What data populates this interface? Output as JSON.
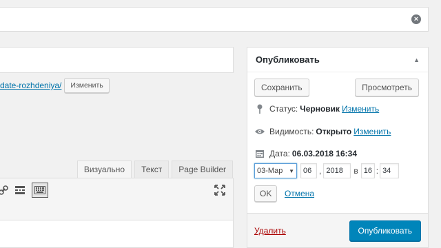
{
  "permalink": {
    "slug": "date-rozhdeniya/",
    "edit_label": "Изменить"
  },
  "editor": {
    "tabs": [
      "Визуально",
      "Текст",
      "Page Builder"
    ]
  },
  "publish": {
    "title": "Опубликовать",
    "save_label": "Сохранить",
    "preview_label": "Просмотреть",
    "status_label": "Статус:",
    "status_value": "Черновик",
    "status_edit": "Изменить",
    "visibility_label": "Видимость:",
    "visibility_value": "Открыто",
    "visibility_edit": "Изменить",
    "date_label": "Дата:",
    "date_value": "06.03.2018 16:34",
    "month_selected": "03-Мар",
    "day": "06",
    "year": "2018",
    "at": "в",
    "hour": "16",
    "minute": "34",
    "ok_label": "OK",
    "cancel_label": "Отмена",
    "delete_label": "Удалить",
    "publish_label": "Опубликовать"
  }
}
